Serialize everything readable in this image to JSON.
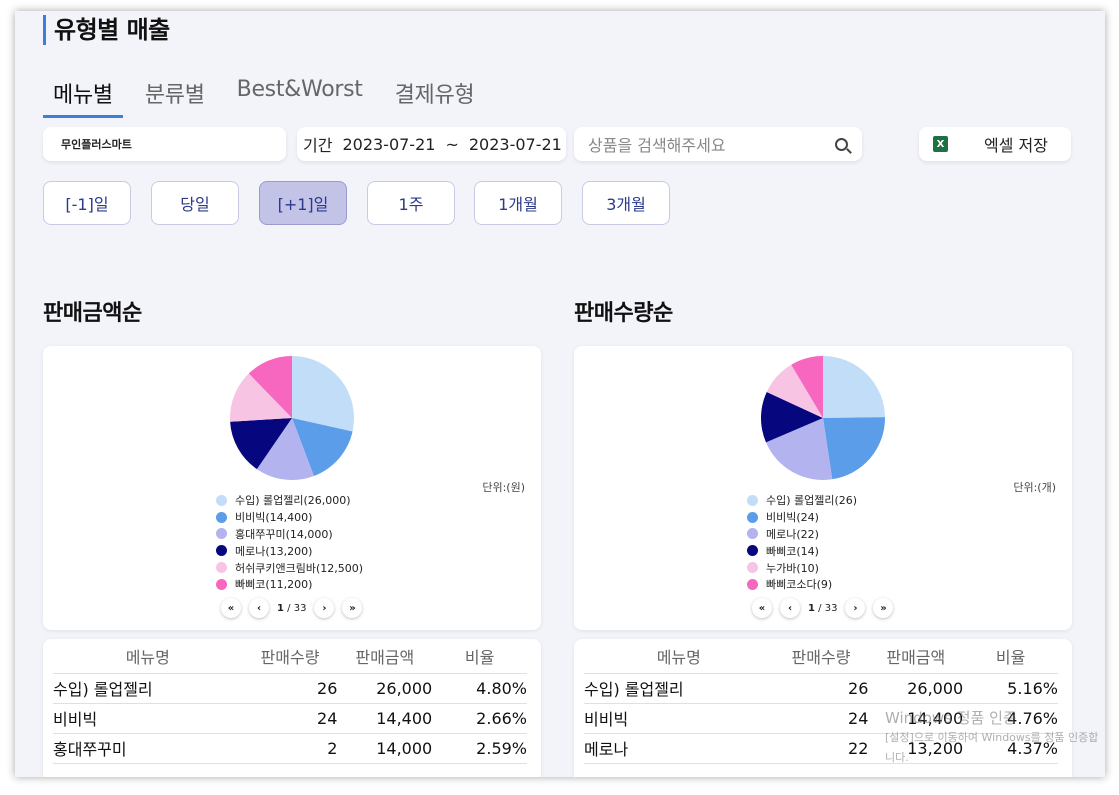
{
  "page": {
    "title": "유형별 매출"
  },
  "tabs": [
    "메뉴별",
    "분류별",
    "Best&Worst",
    "결제유형"
  ],
  "filters": {
    "store": "무인플러스마트",
    "period_label": "기간",
    "start_date": "2023-07-21",
    "tilde": "~",
    "end_date": "2023-07-21",
    "search_placeholder": "상품을 검색해주세요",
    "excel_label": "엑셀 저장",
    "excel_icon_letter": "X"
  },
  "quick_ranges": [
    "[-1]일",
    "당일",
    "[+1]일",
    "1주",
    "1개월",
    "3개월"
  ],
  "selected_range": "[+1]일",
  "left": {
    "section_title": "판매금액순",
    "unit": "단위:(원)",
    "legend": [
      "수입) 롤업젤리(26,000)",
      "비비빅(14,400)",
      "홍대쭈꾸미(14,000)",
      "메로나(13,200)",
      "허쉬쿠키앤크림바(12,500)",
      "빠삐코(11,200)"
    ],
    "pager": {
      "first": "«",
      "prev": "‹",
      "current": "1",
      "total": "/ 33",
      "next": "›",
      "last": "»"
    },
    "table": {
      "headers": [
        "메뉴명",
        "판매수량",
        "판매금액",
        "비율"
      ],
      "rows": [
        [
          "수입) 롤업젤리",
          "26",
          "26,000",
          "4.80%"
        ],
        [
          "비비빅",
          "24",
          "14,400",
          "2.66%"
        ],
        [
          "홍대쭈꾸미",
          "2",
          "14,000",
          "2.59%"
        ]
      ]
    }
  },
  "right": {
    "section_title": "판매수량순",
    "unit": "단위:(개)",
    "legend": [
      "수입) 롤업젤리(26)",
      "비비빅(24)",
      "메로나(22)",
      "빠삐코(14)",
      "누가바(10)",
      "빠삐코소다(9)"
    ],
    "pager": {
      "first": "«",
      "prev": "‹",
      "current": "1",
      "total": "/ 33",
      "next": "›",
      "last": "»"
    },
    "table": {
      "headers": [
        "메뉴명",
        "판매수량",
        "판매금액",
        "비율"
      ],
      "rows": [
        [
          "수입) 롤업젤리",
          "26",
          "26,000",
          "5.16%"
        ],
        [
          "비비빅",
          "24",
          "14,400",
          "4.76%"
        ],
        [
          "메로나",
          "22",
          "13,200",
          "4.37%"
        ]
      ]
    }
  },
  "slice_colors": [
    "#c2ddf7",
    "#5b9de8",
    "#b3b3f0",
    "#06067e",
    "#f8c4e4",
    "#f766bf"
  ],
  "chart_data": [
    {
      "type": "pie",
      "labels": [
        "수입) 롤업젤리",
        "비비빅",
        "홍대쭈꾸미",
        "메로나",
        "허쉬쿠키앤크림바",
        "빠삐코"
      ],
      "values": [
        26000,
        14400,
        14000,
        13200,
        12500,
        11200
      ]
    },
    {
      "type": "pie",
      "labels": [
        "수입) 롤업젤리",
        "비비빅",
        "메로나",
        "빠삐코",
        "누가바",
        "빠삐코소다"
      ],
      "values": [
        26,
        24,
        22,
        14,
        10,
        9
      ]
    }
  ],
  "watermark": {
    "line1": "Windows 정품 인증",
    "line2": "[설정]으로 이동하여 Windows를 정품 인증합니다."
  }
}
